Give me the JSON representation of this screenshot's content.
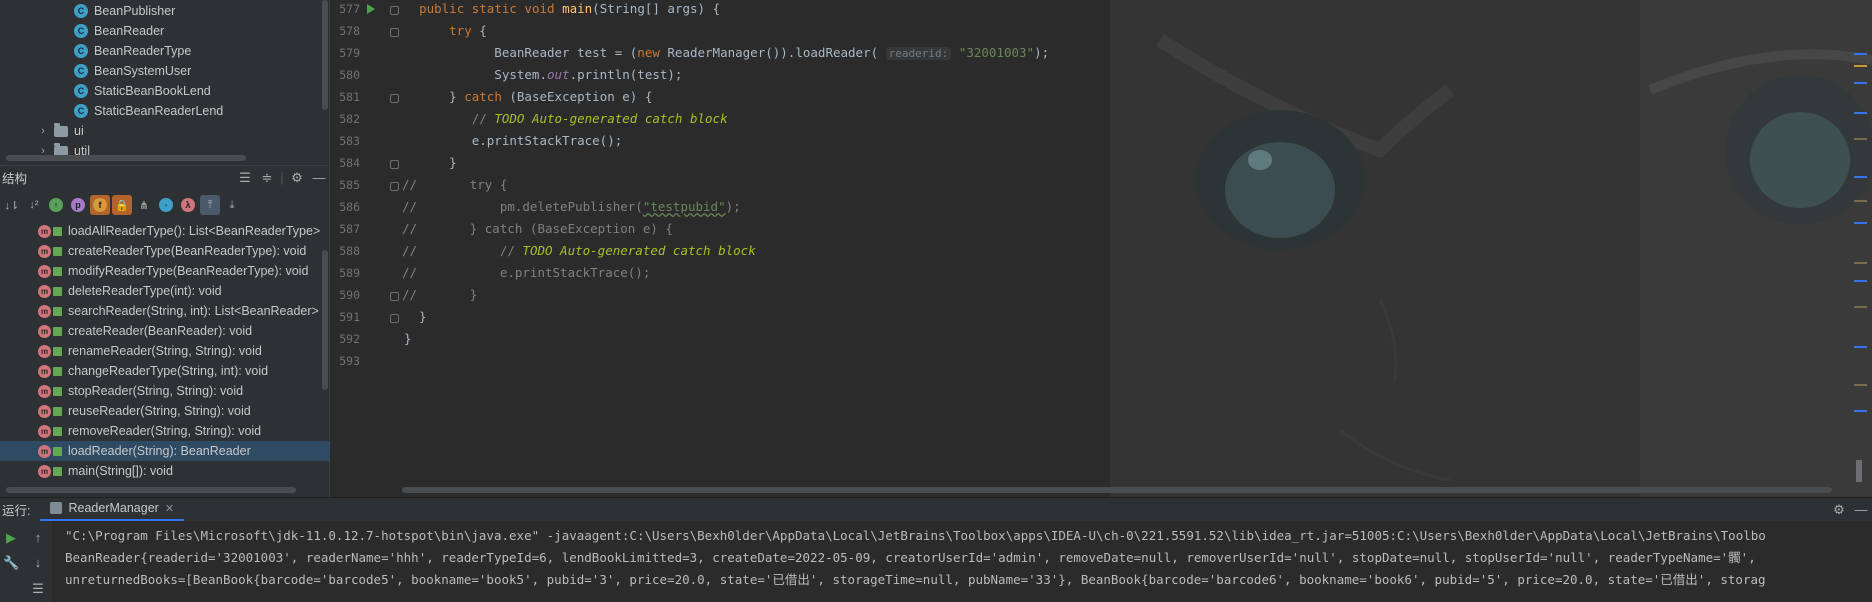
{
  "project_tree": {
    "classes": [
      "BeanPublisher",
      "BeanReader",
      "BeanReaderType",
      "BeanSystemUser",
      "StaticBeanBookLend",
      "StaticBeanReaderLend"
    ],
    "packages": [
      "ui",
      "util"
    ]
  },
  "structure": {
    "title": "结构",
    "methods": [
      "loadAllReaderType(): List<BeanReaderType>",
      "createReaderType(BeanReaderType): void",
      "modifyReaderType(BeanReaderType): void",
      "deleteReaderType(int): void",
      "searchReader(String, int): List<BeanReader>",
      "createReader(BeanReader): void",
      "renameReader(String, String): void",
      "changeReaderType(String, int): void",
      "stopReader(String, String): void",
      "reuseReader(String, String): void",
      "removeReader(String, String): void",
      "loadReader(String): BeanReader",
      "main(String[]): void"
    ],
    "selected_index": 11
  },
  "editor": {
    "line_numbers": [
      "577",
      "578",
      "579",
      "580",
      "581",
      "582",
      "583",
      "584",
      "585",
      "586",
      "587",
      "588",
      "589",
      "590",
      "591",
      "592",
      "593"
    ],
    "param_hint": "readerid:",
    "reader_id_literal": "\"32001003\"",
    "publisher_literal": "\"testpubid\"",
    "todo_text": "TODO Auto-generated catch block"
  },
  "run": {
    "label": "运行:",
    "tab": "ReaderManager",
    "console": [
      "\"C:\\Program Files\\Microsoft\\jdk-11.0.12.7-hotspot\\bin\\java.exe\" -javaagent:C:\\Users\\Bexh0lder\\AppData\\Local\\JetBrains\\Toolbox\\apps\\IDEA-U\\ch-0\\221.5591.52\\lib\\idea_rt.jar=51005:C:\\Users\\Bexh0lder\\AppData\\Local\\JetBrains\\Toolbo",
      "BeanReader{readerid='32001003', readerName='hhh', readerTypeId=6, lendBookLimitted=3, createDate=2022-05-09, creatorUserId='admin', removeDate=null, removerUserId='null', stopDate=null, stopUserId='null', readerTypeName='髑',",
      "unreturnedBooks=[BeanBook{barcode='barcode5', bookname='book5', pubid='3', price=20.0, state='已借出', storageTime=null, pubName='33'}, BeanBook{barcode='barcode6', bookname='book6', pubid='5', price=20.0, state='已借出', storag"
    ]
  },
  "colors": {
    "keyword": "#cc7832",
    "function": "#ffc66d",
    "string": "#6a8759",
    "comment": "#808080",
    "todo": "#a8c023",
    "selection": "#2f4a63",
    "tab_underline": "#3574f0"
  }
}
